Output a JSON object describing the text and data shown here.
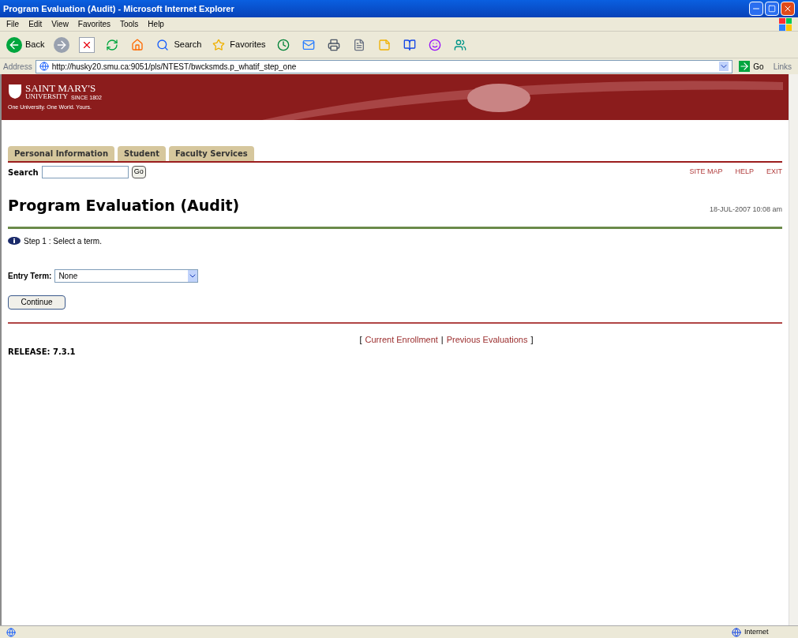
{
  "window": {
    "title": "Program Evaluation (Audit) - Microsoft Internet Explorer"
  },
  "menu": [
    "File",
    "Edit",
    "View",
    "Favorites",
    "Tools",
    "Help"
  ],
  "toolbar": [
    {
      "kind": "back",
      "label": "Back"
    },
    {
      "kind": "forward"
    },
    {
      "kind": "stop"
    },
    {
      "kind": "refresh"
    },
    {
      "kind": "home"
    },
    {
      "kind": "search",
      "label": "Search"
    },
    {
      "kind": "favorites",
      "label": "Favorites"
    },
    {
      "kind": "history"
    },
    {
      "kind": "mail"
    },
    {
      "kind": "print"
    },
    {
      "kind": "edit"
    },
    {
      "kind": "note"
    },
    {
      "kind": "research"
    },
    {
      "kind": "messenger"
    },
    {
      "kind": "people"
    }
  ],
  "address": {
    "label": "Address",
    "url": "http://husky20.smu.ca:9051/pls/NTEST/bwcksmds.p_whatif_step_one",
    "go": "Go",
    "links": "Links"
  },
  "banner": {
    "name": "SAINT MARY'S",
    "university": "UNIVERSITY",
    "since": "SINCE 1802",
    "tagline": "One University. One World. Yours."
  },
  "tabs": [
    {
      "label": "Personal Information",
      "selected": false
    },
    {
      "label": "Student",
      "selected": false
    },
    {
      "label": "Faculty Services",
      "selected": false
    }
  ],
  "search": {
    "label": "Search",
    "button": "Go"
  },
  "top_links": [
    "SITE MAP",
    "HELP",
    "EXIT"
  ],
  "page": {
    "title": "Program Evaluation (Audit)",
    "timestamp": "18-JUL-2007 10:08 am",
    "info": "Step 1 : Select a term.",
    "entry_label": "Entry Term:",
    "entry_value": "None",
    "continue": "Continue"
  },
  "footer_links": [
    "Current Enrollment",
    "Previous Evaluations"
  ],
  "footer_marks": {
    "open": "[",
    "separator": "|",
    "close": "]"
  },
  "release": "RELEASE: 7.3.1",
  "status_bar": {
    "zone": "Internet"
  }
}
